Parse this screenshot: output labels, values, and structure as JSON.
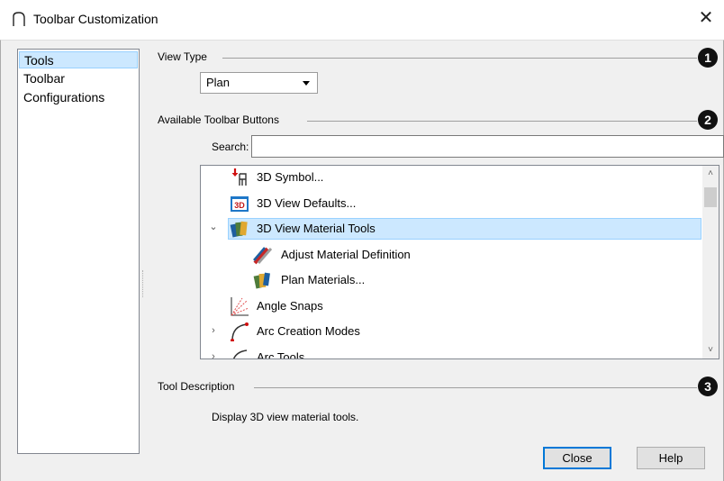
{
  "window": {
    "title": "Toolbar Customization",
    "close_glyph": "✕"
  },
  "sidebar": {
    "items": [
      {
        "label": "Tools",
        "selected": true
      },
      {
        "label": "Toolbar",
        "selected": false
      },
      {
        "label": "Configurations",
        "selected": false
      }
    ]
  },
  "view_type": {
    "label": "View Type",
    "badge": "1",
    "selected_value": "Plan"
  },
  "available": {
    "label": "Available Toolbar Buttons",
    "badge": "2",
    "search_label": "Search:",
    "search_value": ""
  },
  "tree": {
    "items": [
      {
        "label": "3D Symbol...",
        "icon": "3d-symbol-icon",
        "expander": ""
      },
      {
        "label": "3D View Defaults...",
        "icon": "3d-view-defaults-icon",
        "icon_text": "3D",
        "expander": ""
      },
      {
        "label": "3D View Material Tools",
        "icon": "material-tools-icon",
        "expander": "⌄",
        "selected": true
      },
      {
        "label": "Adjust Material Definition",
        "icon": "adjust-material-icon",
        "expander": ""
      },
      {
        "label": "Plan Materials...",
        "icon": "plan-materials-icon",
        "expander": ""
      },
      {
        "label": "Angle Snaps",
        "icon": "angle-snaps-icon",
        "expander": ""
      },
      {
        "label": "Arc Creation Modes",
        "icon": "arc-creation-icon",
        "expander": "›"
      },
      {
        "label": "Arc Tools",
        "icon": "arc-tools-icon",
        "expander": "›"
      }
    ],
    "scroll_up": "˄",
    "scroll_down": "˅"
  },
  "description": {
    "label": "Tool Description",
    "badge": "3",
    "text": "Display 3D view material tools."
  },
  "buttons": {
    "close": "Close",
    "help": "Help"
  },
  "colors": {
    "selection_bg": "#cce8ff",
    "selection_border": "#99d1ff",
    "default_button_border": "#0078d7",
    "dialog_bg": "#f0f0f0"
  }
}
